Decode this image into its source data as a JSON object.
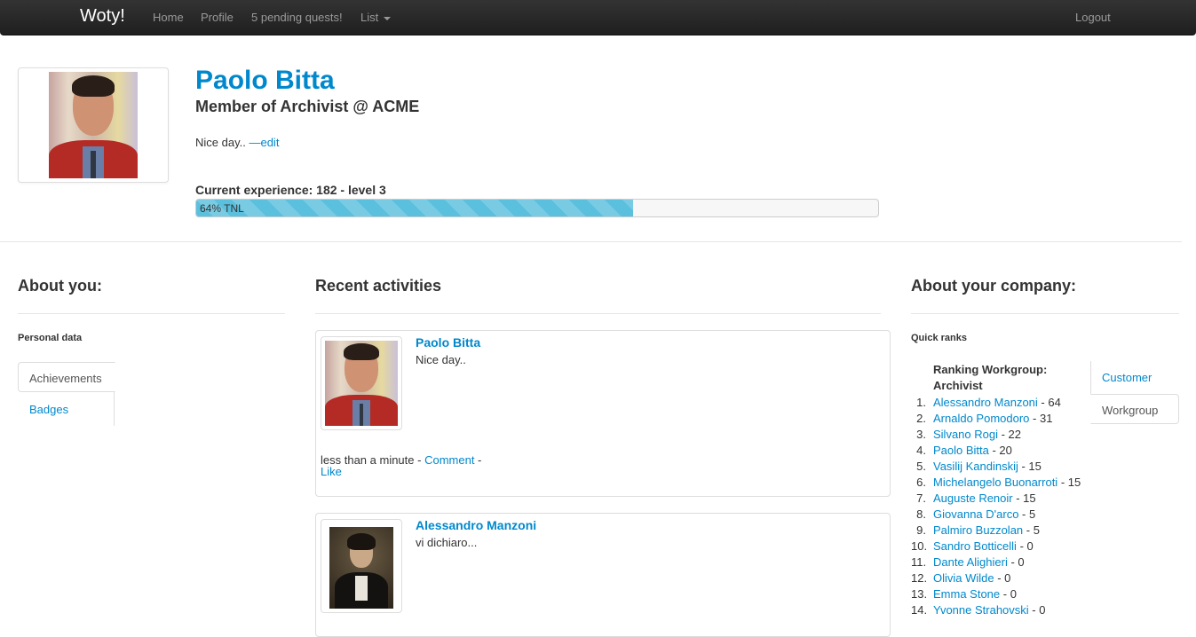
{
  "navbar": {
    "brand": "Woty!",
    "links": {
      "home": "Home",
      "profile": "Profile",
      "quests": "5 pending quests!",
      "list": "List"
    },
    "logout": "Logout"
  },
  "profile": {
    "name": "Paolo Bitta",
    "membership": "Member of Archivist @ ACME",
    "status": "Nice day..",
    "edit_label": "—edit",
    "experience_label": "Current experience: 182 - level 3",
    "progress_percent": 64,
    "progress_label": "64% TNL"
  },
  "about_you": {
    "title": "About you:",
    "personal_data": "Personal data",
    "tabs": {
      "achievements": "Achievements",
      "badges": "Badges"
    }
  },
  "activities": {
    "title": "Recent activities",
    "items": [
      {
        "author": "Paolo Bitta",
        "text": "Nice day..",
        "time": "less than a minute",
        "separator": " - ",
        "comment": "Comment",
        "like": "Like"
      },
      {
        "author": "Alessandro Manzoni",
        "text": "vi dichiaro..."
      }
    ]
  },
  "company": {
    "title": "About your company:",
    "quick_ranks": "Quick ranks",
    "ranking_title": "Ranking Workgroup: Archivist",
    "tabs": {
      "customer": "Customer",
      "workgroup": "Workgroup"
    },
    "ranks": [
      {
        "num": "1.",
        "name": "Alessandro Manzoni",
        "score": " - 64"
      },
      {
        "num": "2.",
        "name": "Arnaldo Pomodoro",
        "score": " - 31"
      },
      {
        "num": "3.",
        "name": "Silvano Rogi",
        "score": " - 22"
      },
      {
        "num": "4.",
        "name": "Paolo Bitta",
        "score": " - 20"
      },
      {
        "num": "5.",
        "name": "Vasilij Kandinskij",
        "score": " - 15"
      },
      {
        "num": "6.",
        "name": "Michelangelo Buonarroti",
        "score": " - 15"
      },
      {
        "num": "7.",
        "name": "Auguste Renoir",
        "score": " - 15"
      },
      {
        "num": "8.",
        "name": "Giovanna D'arco",
        "score": " - 5"
      },
      {
        "num": "9.",
        "name": "Palmiro Buzzolan",
        "score": " - 5"
      },
      {
        "num": "10.",
        "name": "Sandro Botticelli",
        "score": " - 0"
      },
      {
        "num": "11.",
        "name": "Dante Alighieri",
        "score": " - 0"
      },
      {
        "num": "12.",
        "name": "Olivia Wilde",
        "score": " - 0"
      },
      {
        "num": "13.",
        "name": "Emma Stone",
        "score": " - 0"
      },
      {
        "num": "14.",
        "name": "Yvonne Strahovski",
        "score": " - 0"
      }
    ]
  }
}
